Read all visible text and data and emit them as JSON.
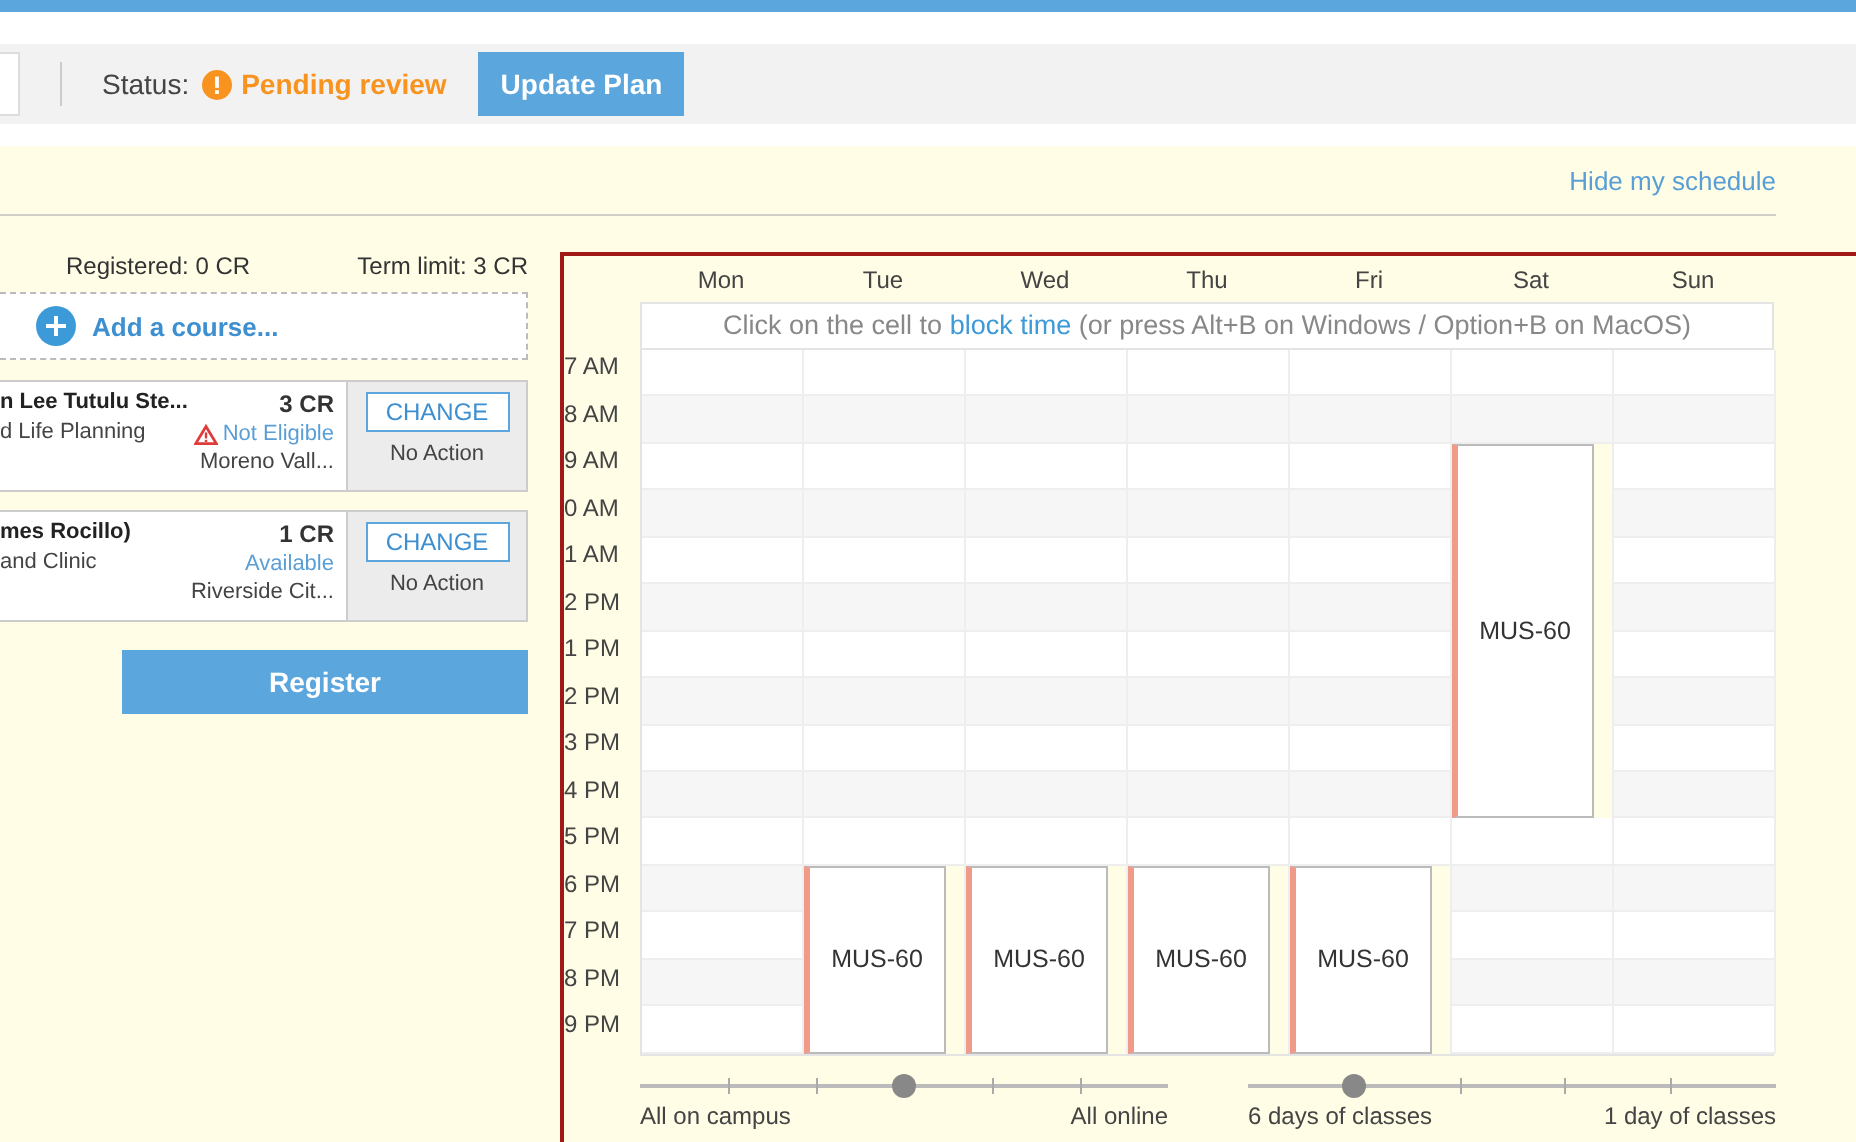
{
  "toolbar": {
    "status_label": "Status:",
    "status": "Pending review",
    "update_button": "Update Plan"
  },
  "hide_schedule_link": "Hide my schedule",
  "summary": {
    "registered": "Registered: 0 CR",
    "term_limit": "Term limit: 3 CR"
  },
  "add_course": "Add a course...",
  "courses": [
    {
      "title": "n Lee Tutulu Ste...",
      "subtitle": "d Life Planning",
      "credits": "3 CR",
      "availability": "Not Eligible",
      "warning": true,
      "location": "Moreno Vall...",
      "change_button": "CHANGE",
      "action": "No Action"
    },
    {
      "title": "mes Rocillo)",
      "subtitle": "and Clinic",
      "credits": "1 CR",
      "availability": "Available",
      "warning": false,
      "location": "Riverside Cit...",
      "change_button": "CHANGE",
      "action": "No Action"
    }
  ],
  "register_button": "Register",
  "calendar": {
    "days": [
      {
        "label": "Mon",
        "slots": [
          {
            "booked": false
          },
          {
            "booked": false
          },
          {
            "booked": false
          },
          {
            "booked": false
          },
          {
            "booked": false
          },
          {
            "booked": false
          },
          {
            "booked": false
          },
          {
            "booked": false
          },
          {
            "booked": false
          },
          {
            "booked": false
          },
          {
            "booked": false
          },
          {
            "booked": false
          },
          {
            "booked": false
          },
          {
            "booked": false
          },
          {
            "booked": false
          }
        ]
      },
      {
        "label": "Tue",
        "slots": [
          {
            "booked": false
          },
          {
            "booked": false
          },
          {
            "booked": false
          },
          {
            "booked": false
          },
          {
            "booked": false
          },
          {
            "booked": false
          },
          {
            "booked": false
          },
          {
            "booked": false
          },
          {
            "booked": false
          },
          {
            "booked": false
          },
          {
            "booked": false
          },
          {
            "booked": true
          },
          {
            "booked": true
          },
          {
            "booked": true
          },
          {
            "booked": true
          }
        ],
        "events": [
          {
            "label": "MUS-60"
          }
        ]
      },
      {
        "label": "Wed",
        "slots": [
          {
            "booked": false
          },
          {
            "booked": false
          },
          {
            "booked": false
          },
          {
            "booked": false
          },
          {
            "booked": false
          },
          {
            "booked": false
          },
          {
            "booked": false
          },
          {
            "booked": false
          },
          {
            "booked": false
          },
          {
            "booked": false
          },
          {
            "booked": false
          },
          {
            "booked": true
          },
          {
            "booked": true
          },
          {
            "booked": true
          },
          {
            "booked": true
          }
        ],
        "events": [
          {
            "label": "MUS-60"
          }
        ]
      },
      {
        "label": "Thu",
        "slots": [
          {
            "booked": false
          },
          {
            "booked": false
          },
          {
            "booked": false
          },
          {
            "booked": false
          },
          {
            "booked": false
          },
          {
            "booked": false
          },
          {
            "booked": false
          },
          {
            "booked": false
          },
          {
            "booked": false
          },
          {
            "booked": false
          },
          {
            "booked": false
          },
          {
            "booked": true
          },
          {
            "booked": true
          },
          {
            "booked": true
          },
          {
            "booked": true
          }
        ],
        "events": [
          {
            "label": "MUS-60"
          }
        ]
      },
      {
        "label": "Fri",
        "slots": [
          {
            "booked": false
          },
          {
            "booked": false
          },
          {
            "booked": false
          },
          {
            "booked": false
          },
          {
            "booked": false
          },
          {
            "booked": false
          },
          {
            "booked": false
          },
          {
            "booked": false
          },
          {
            "booked": false
          },
          {
            "booked": false
          },
          {
            "booked": false
          },
          {
            "booked": true
          },
          {
            "booked": true
          },
          {
            "booked": true
          },
          {
            "booked": true
          }
        ],
        "events": [
          {
            "label": "MUS-60"
          }
        ]
      },
      {
        "label": "Sat",
        "slots": [
          {
            "booked": false
          },
          {
            "booked": false
          },
          {
            "booked": true
          },
          {
            "booked": true
          },
          {
            "booked": true
          },
          {
            "booked": true
          },
          {
            "booked": true
          },
          {
            "booked": true
          },
          {
            "booked": true
          },
          {
            "booked": true
          },
          {
            "booked": false
          },
          {
            "booked": false
          },
          {
            "booked": false
          },
          {
            "booked": false
          },
          {
            "booked": false
          }
        ],
        "events": [
          {
            "label": "MUS-60"
          }
        ]
      },
      {
        "label": "Sun",
        "slots": [
          {
            "booked": false
          },
          {
            "booked": false
          },
          {
            "booked": false
          },
          {
            "booked": false
          },
          {
            "booked": false
          },
          {
            "booked": false
          },
          {
            "booked": false
          },
          {
            "booked": false
          },
          {
            "booked": false
          },
          {
            "booked": false
          },
          {
            "booked": false
          },
          {
            "booked": false
          },
          {
            "booked": false
          },
          {
            "booked": false
          },
          {
            "booked": false
          }
        ]
      }
    ],
    "hint_before": "Click on the cell to ",
    "hint_link": "block time",
    "hint_after": " (or press Alt+B on Windows / Option+B on MacOS)",
    "times": [
      "7 AM",
      "8 AM",
      "9 AM",
      "0 AM",
      "1 AM",
      "2 PM",
      "1 PM",
      "2 PM",
      "3 PM",
      "4 PM",
      "5 PM",
      "6 PM",
      "7 PM",
      "8 PM",
      "9 PM"
    ]
  },
  "sliders": [
    {
      "left_label": "All on campus",
      "right_label": "All online",
      "level": 0.5
    },
    {
      "left_label": "6 days of classes",
      "right_label": "1 day of classes",
      "level": 0.2
    }
  ]
}
